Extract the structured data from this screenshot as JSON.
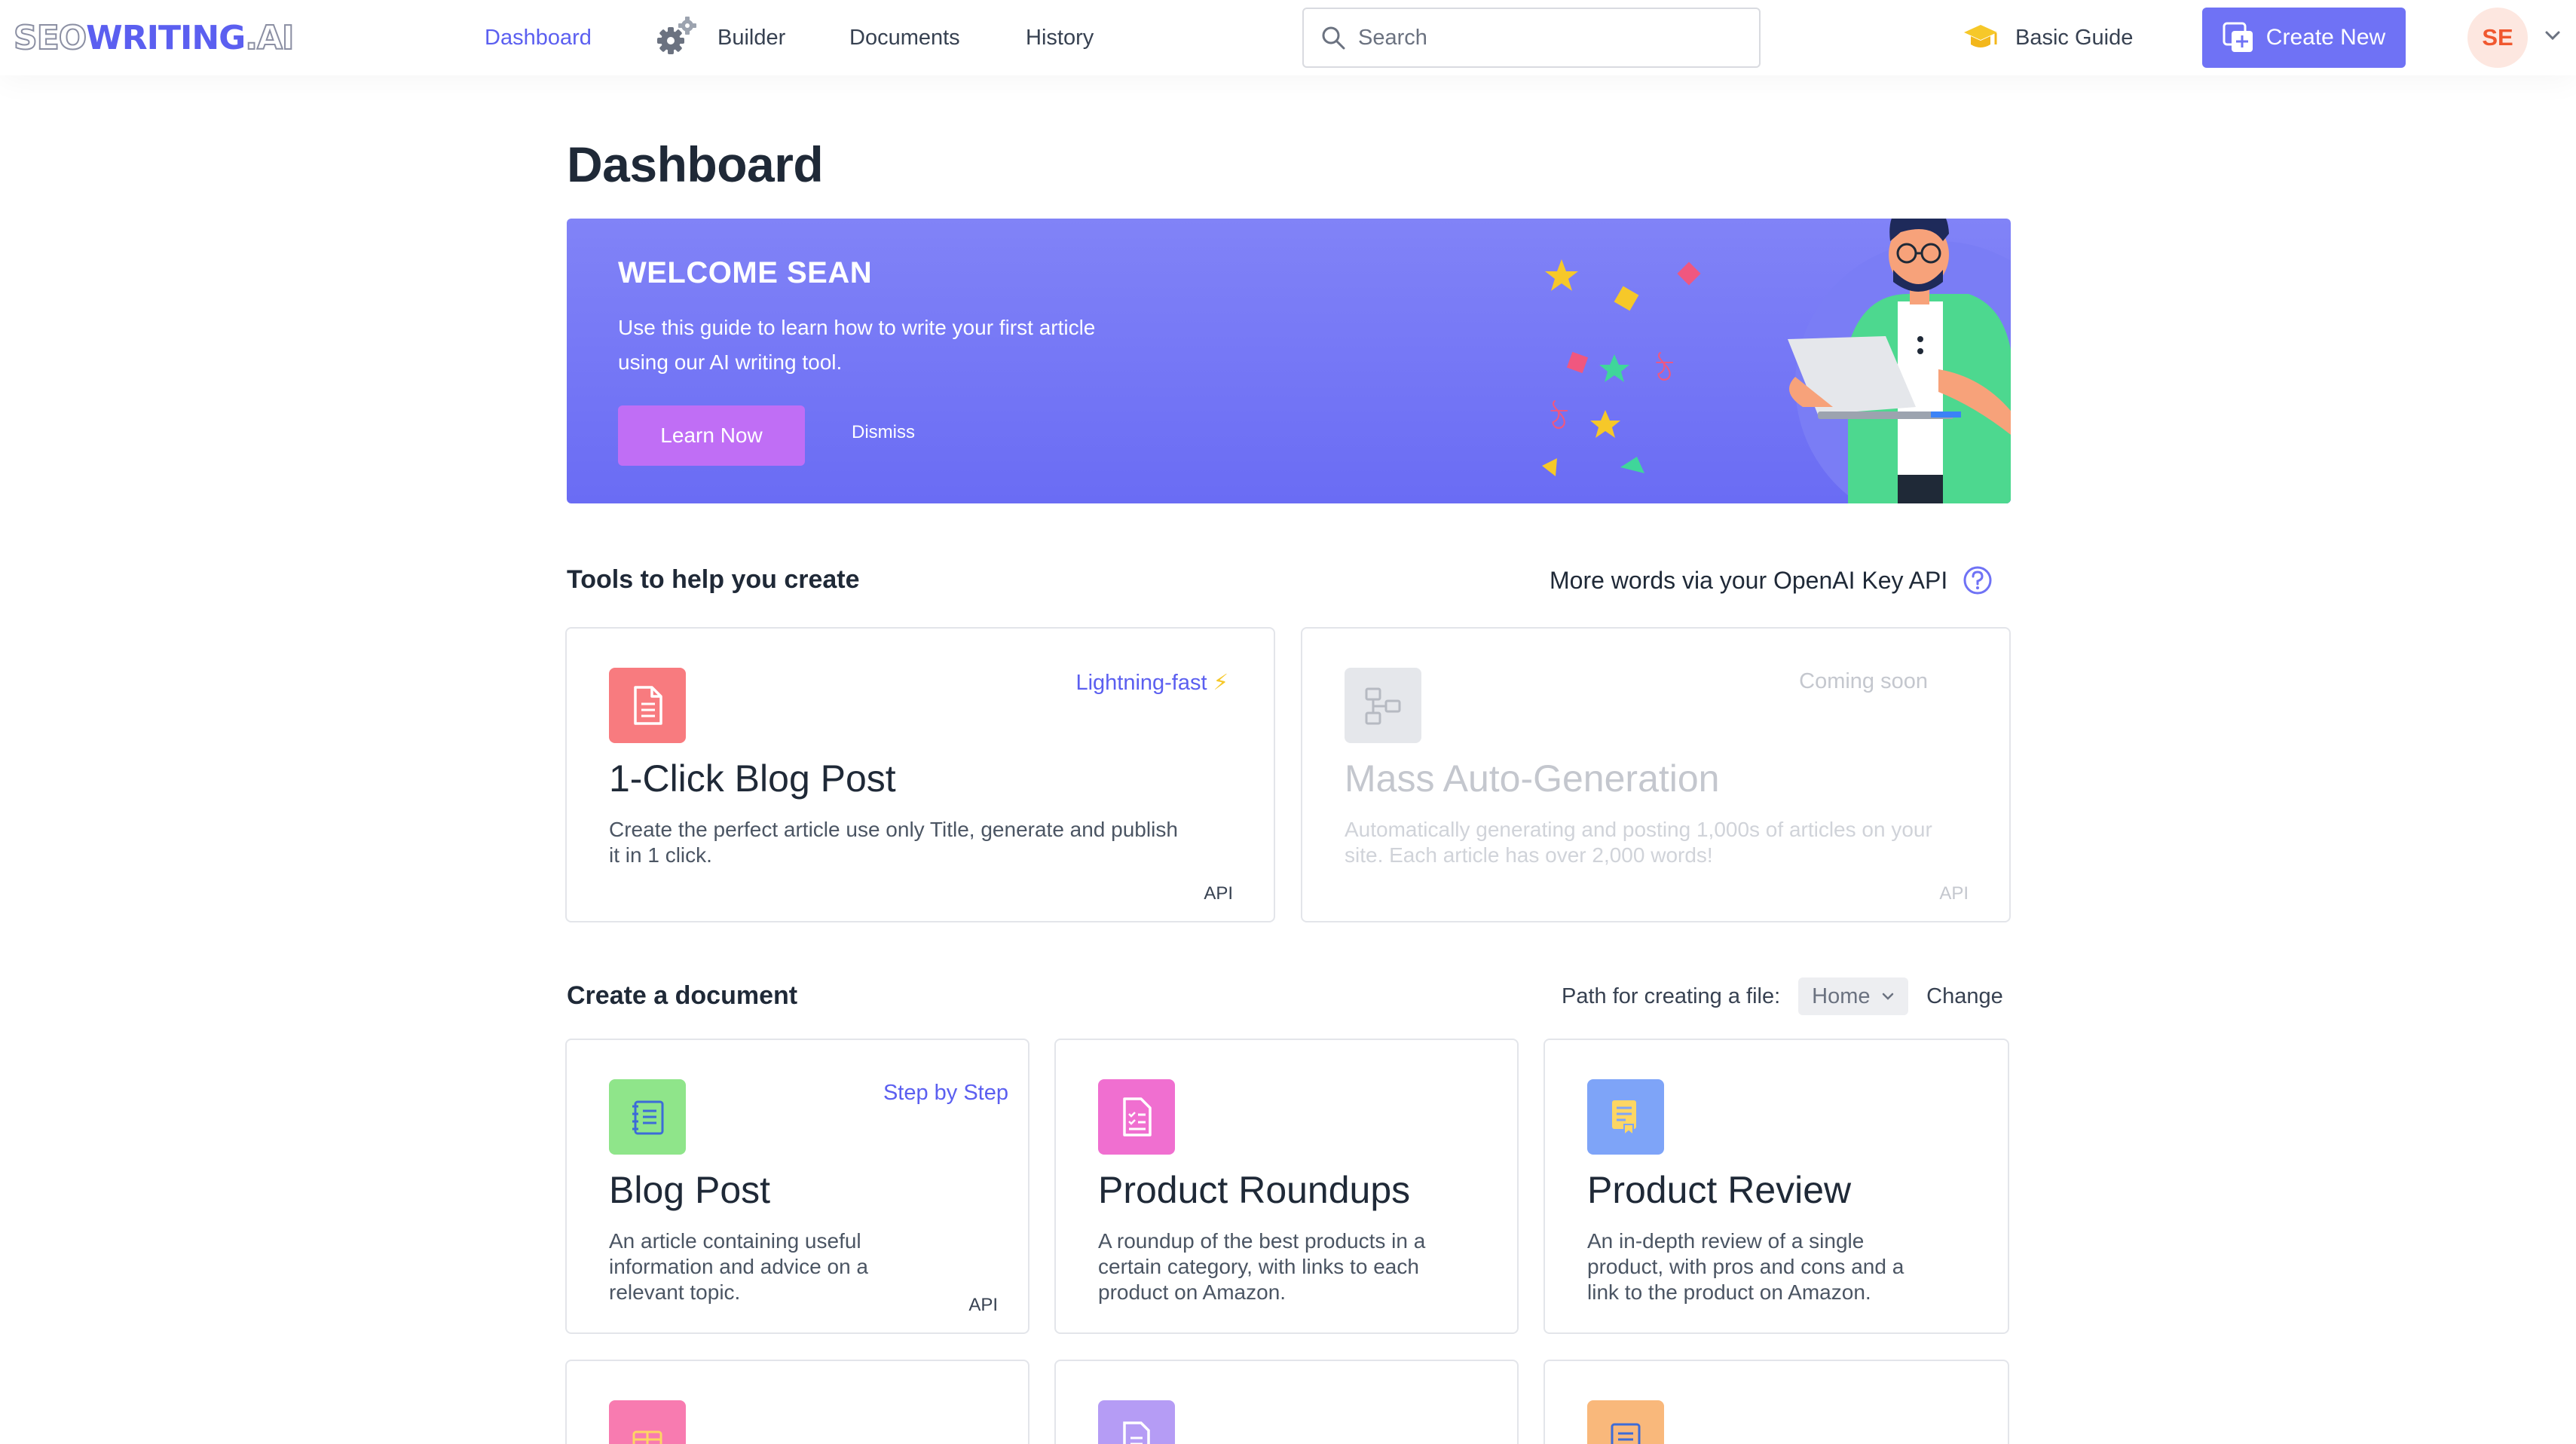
{
  "logo": {
    "part1": "SEO",
    "part2": "WRITING",
    "part3": ".AI"
  },
  "nav": {
    "dashboard": "Dashboard",
    "builder": "Builder",
    "documents": "Documents",
    "history": "History"
  },
  "search": {
    "placeholder": "Search"
  },
  "header": {
    "guide_label": "Basic Guide",
    "create_label": "Create New",
    "avatar_initials": "SE"
  },
  "colors": {
    "accent": "#6f72f5",
    "nav_active": "#5b5ff0",
    "banner_button": "#c06ef5",
    "avatar_text": "#f0582f"
  },
  "page": {
    "title": "Dashboard"
  },
  "banner": {
    "title": "WELCOME SEAN",
    "text": "Use this guide to learn how to write your first article using our AI writing tool.",
    "learn_label": "Learn Now",
    "dismiss_label": "Dismiss"
  },
  "tools": {
    "section_title": "Tools to help you create",
    "api_link": "More words via your OpenAI Key API",
    "cards": [
      {
        "title": "1-Click Blog Post",
        "tag": "Lightning-fast",
        "desc": "Create the perfect article use only Title, generate and publish it in 1 click.",
        "api": "API",
        "icon": "document-icon"
      },
      {
        "title": "Mass Auto-Generation",
        "tag": "Coming soon",
        "desc": "Automatically generating and posting 1,000s of articles on your site. Each article has over 2,000 words!",
        "api": "API",
        "icon": "flowchart-icon"
      }
    ]
  },
  "documents": {
    "section_title": "Create a document",
    "path_label": "Path for creating a file:",
    "path_value": "Home",
    "change_label": "Change",
    "cards": [
      {
        "title": "Blog Post",
        "tag": "Step by Step",
        "desc": "An article containing useful information and advice on a relevant topic.",
        "api": "API",
        "icon": "notebook-icon"
      },
      {
        "title": "Product Roundups",
        "desc": "A roundup of the best products in a certain category, with links to each product on Amazon.",
        "icon": "checklist-icon"
      },
      {
        "title": "Product Review",
        "desc": "An in-depth review of a single product, with pros and cons and a link to the product on Amazon.",
        "icon": "review-icon"
      }
    ]
  }
}
